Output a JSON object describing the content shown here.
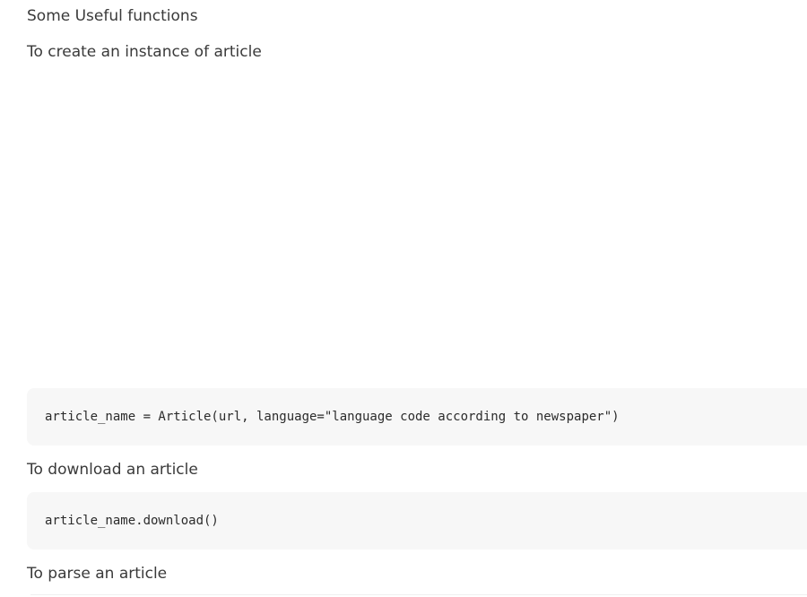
{
  "content": {
    "heading": "Some Useful functions",
    "create_instance_label": "To create an instance of article",
    "create_instance_code": "article_name = Article(url, language=\"language code according to newspaper\")",
    "download_label": "To download an article",
    "download_code": "article_name.download()",
    "parse_label": "To parse an article"
  }
}
